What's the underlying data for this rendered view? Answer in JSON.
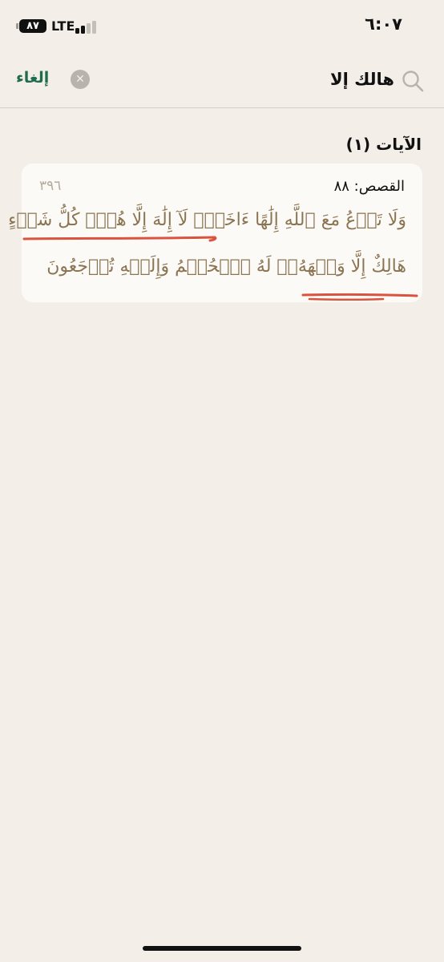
{
  "status_bar": {
    "time": "٦:٠٧",
    "battery": "٨٧",
    "network": "LTE"
  },
  "search": {
    "query": "هالك إلا",
    "cancel_label": "إلغاء"
  },
  "results": {
    "heading": "الآيات (١)",
    "items": [
      {
        "reference": "القصص: ٨٨",
        "page": "٣٩٦",
        "line1": "وَلَا تَدۡعُ مَعَ ٱللَّهِ إِلَٰهًا ءَاخَرَۘ لَآ إِلَٰهَ إِلَّا هُوَۚ كُلُّ شَيۡءٍ",
        "line2": "هَالِكٌ إِلَّا وَجۡهَهُۥۚ لَهُ ٱلۡحُكۡمُ وَإِلَيۡهِ تُرۡجَعُونَ"
      }
    ]
  },
  "colors": {
    "background": "#f3efe8",
    "card": "#fcfaf6",
    "verse_text": "#8b7452",
    "accent_green": "#1f6b4e",
    "annotation_red": "#d9533f"
  },
  "icons": {
    "search": "search-icon",
    "clear": "clear-icon",
    "battery": "battery-icon",
    "signal": "signal-icon"
  }
}
